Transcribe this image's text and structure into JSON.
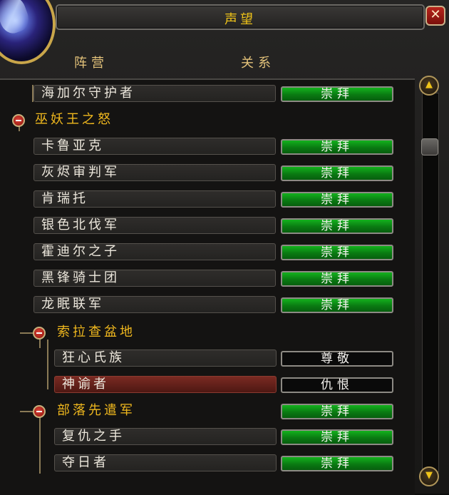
{
  "window": {
    "title": "声望",
    "close_label": "✕"
  },
  "columns": {
    "faction": "阵营",
    "standing": "关系"
  },
  "rows": [
    {
      "kind": "faction",
      "name": "海加尔守护者",
      "standing": "崇拜"
    },
    {
      "kind": "header",
      "name": "巫妖王之怒"
    },
    {
      "kind": "faction",
      "name": "卡鲁亚克",
      "standing": "崇拜"
    },
    {
      "kind": "faction",
      "name": "灰烬审判军",
      "standing": "崇拜"
    },
    {
      "kind": "faction",
      "name": "肯瑞托",
      "standing": "崇拜"
    },
    {
      "kind": "faction",
      "name": "银色北伐军",
      "standing": "崇拜"
    },
    {
      "kind": "faction",
      "name": "霍迪尔之子",
      "standing": "崇拜"
    },
    {
      "kind": "faction",
      "name": "黑锋骑士团",
      "standing": "崇拜"
    },
    {
      "kind": "faction",
      "name": "龙眠联军",
      "standing": "崇拜"
    },
    {
      "kind": "subheader",
      "name": "索拉查盆地"
    },
    {
      "kind": "subfaction",
      "name": "狂心氏族",
      "standing": "尊敬"
    },
    {
      "kind": "subfaction",
      "name": "神谕者",
      "standing": "仇恨"
    },
    {
      "kind": "subheader",
      "name": "部落先遣军",
      "standing": "崇拜"
    },
    {
      "kind": "subfaction",
      "name": "复仇之手",
      "standing": "崇拜"
    },
    {
      "kind": "subfaction",
      "name": "夺日者",
      "standing": "崇拜"
    }
  ],
  "colors": {
    "exalted_bar": "#0f9a18",
    "header_text": "#f0b81e",
    "highlight_row": "#6b241c"
  }
}
